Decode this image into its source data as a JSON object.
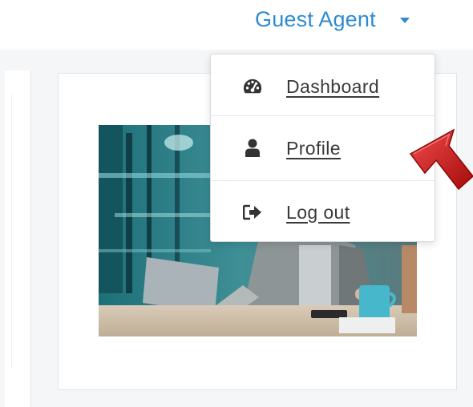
{
  "header": {
    "user_name": "Guest Agent"
  },
  "dropdown": {
    "items": [
      {
        "label": "Dashboard",
        "icon": "dashboard-gauge-icon"
      },
      {
        "label": "Profile",
        "icon": "user-icon"
      },
      {
        "label": "Log out",
        "icon": "sign-out-icon"
      }
    ]
  },
  "colors": {
    "accent": "#2f8bd1",
    "arrow": "#d01414"
  }
}
